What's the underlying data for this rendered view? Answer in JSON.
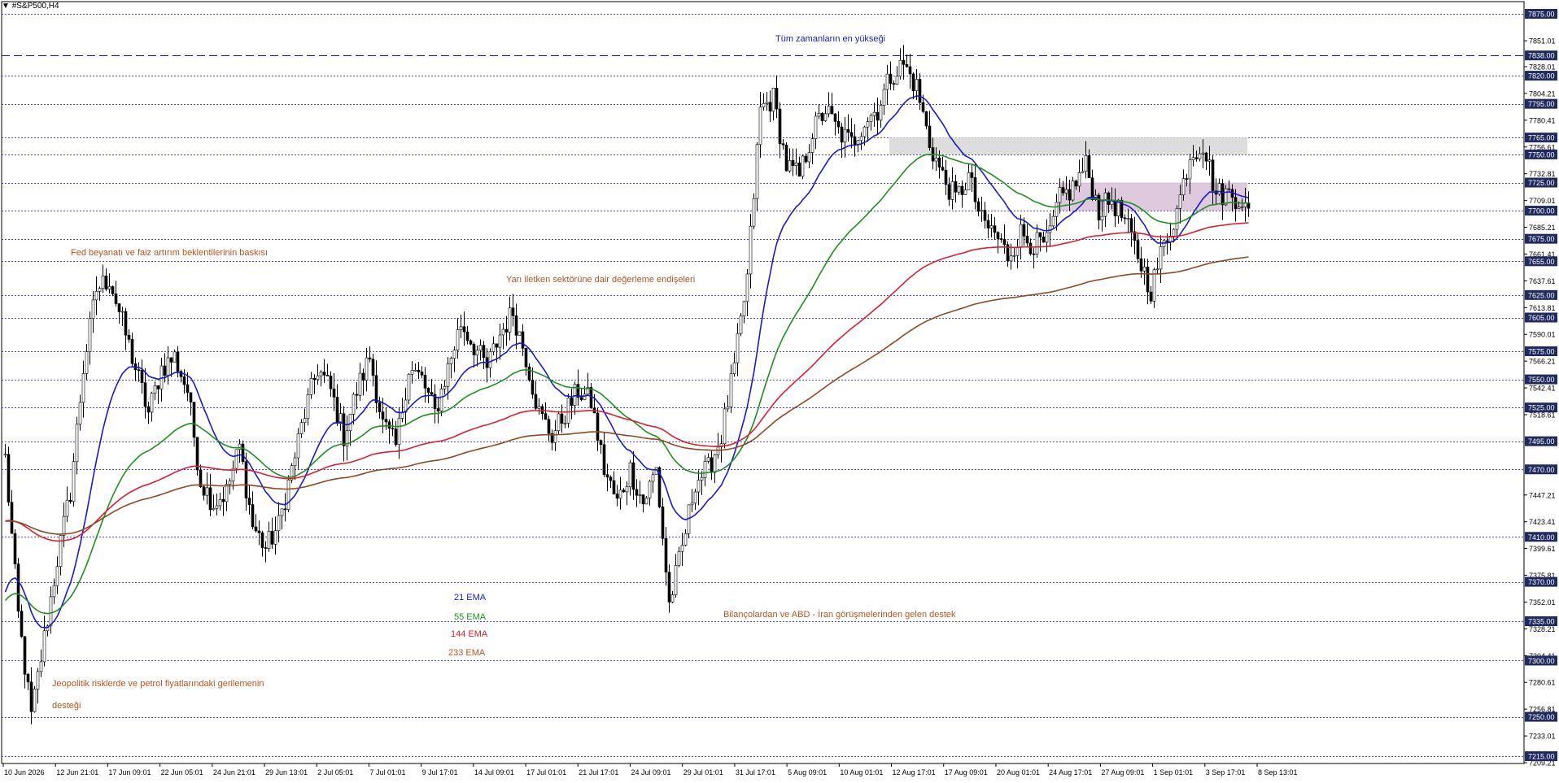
{
  "window": {
    "symbol_label": "#S&P500,H4"
  },
  "chart_data": {
    "type": "candlestick",
    "symbol": "#S&P500",
    "timeframe": "H4",
    "ylim": [
      7209.5,
      7875.0
    ],
    "price_ticks": [
      "7851.01",
      "7828.01",
      "7804.21",
      "7780.41",
      "7756.61",
      "7732.81",
      "7709.01",
      "7685.21",
      "7661.41",
      "7637.61",
      "7613.81",
      "7590.01",
      "7566.21",
      "7542.41",
      "7518.61",
      "7447.21",
      "7423.41",
      "7399.61",
      "7375.81",
      "7352.01",
      "7328.21",
      "7304.41",
      "7280.61",
      "7256.81",
      "7233.01",
      "7209.21"
    ],
    "levels": [
      {
        "value": 7875.0,
        "label": "7875.00",
        "style": "dotted"
      },
      {
        "value": 7838.0,
        "label": "7838.00",
        "style": "dashed"
      },
      {
        "value": 7820.0,
        "label": "7820.00",
        "style": "dotted"
      },
      {
        "value": 7795.0,
        "label": "7795.00",
        "style": "dotted"
      },
      {
        "value": 7765.0,
        "label": "7765.00",
        "style": "dotted"
      },
      {
        "value": 7750.0,
        "label": "7750.00",
        "style": "dotted"
      },
      {
        "value": 7725.0,
        "label": "7725.00",
        "style": "dotted"
      },
      {
        "value": 7700.0,
        "label": "7700.00",
        "style": "dotted"
      },
      {
        "value": 7675.0,
        "label": "7675.00",
        "style": "dotted"
      },
      {
        "value": 7655.0,
        "label": "7655.00",
        "style": "dotted"
      },
      {
        "value": 7625.0,
        "label": "7625.00",
        "style": "dotted"
      },
      {
        "value": 7605.0,
        "label": "7605.00",
        "style": "dotted"
      },
      {
        "value": 7575.0,
        "label": "7575.00",
        "style": "dotted"
      },
      {
        "value": 7550.0,
        "label": "7550.00",
        "style": "dotted"
      },
      {
        "value": 7525.0,
        "label": "7525.00",
        "style": "dotted"
      },
      {
        "value": 7495.0,
        "label": "7495.00",
        "style": "dotted"
      },
      {
        "value": 7470.0,
        "label": "7470.00",
        "style": "dotted"
      },
      {
        "value": 7410.0,
        "label": "7410.00",
        "style": "dotted"
      },
      {
        "value": 7370.0,
        "label": "7370.00",
        "style": "dotted"
      },
      {
        "value": 7335.0,
        "label": "7335.00",
        "style": "dotted"
      },
      {
        "value": 7300.0,
        "label": "7300.00",
        "style": "dotted"
      },
      {
        "value": 7250.0,
        "label": "7250.00",
        "style": "dotted"
      },
      {
        "value": 7215.0,
        "label": "7215.00",
        "style": "dotted"
      }
    ],
    "time_labels": [
      "10 Jun 2026",
      "12 Jun 21:01",
      "17 Jun 09:01",
      "22 Jun 05:01",
      "24 Jun 21:01",
      "29 Jun 13:01",
      "2 Jul 05:01",
      "7 Jul 01:01",
      "9 Jul 17:01",
      "14 Jul 09:01",
      "17 Jul 01:01",
      "21 Jul 17:01",
      "24 Jul 09:01",
      "29 Jul 01:01",
      "31 Jul 17:01",
      "5 Aug 09:01",
      "10 Aug 01:01",
      "12 Aug 17:01",
      "17 Aug 09:01",
      "20 Aug 01:01",
      "24 Aug 17:01",
      "27 Aug 09:01",
      "1 Sep 01:01",
      "3 Sep 17:01",
      "8 Sep 13:01"
    ],
    "price_anchors": [
      [
        0,
        7480
      ],
      [
        4,
        7340
      ],
      [
        8,
        7250
      ],
      [
        12,
        7320
      ],
      [
        16,
        7390
      ],
      [
        20,
        7450
      ],
      [
        24,
        7560
      ],
      [
        28,
        7630
      ],
      [
        32,
        7640
      ],
      [
        36,
        7600
      ],
      [
        40,
        7560
      ],
      [
        44,
        7520
      ],
      [
        48,
        7560
      ],
      [
        52,
        7570
      ],
      [
        56,
        7540
      ],
      [
        60,
        7460
      ],
      [
        64,
        7440
      ],
      [
        68,
        7450
      ],
      [
        72,
        7490
      ],
      [
        76,
        7420
      ],
      [
        80,
        7400
      ],
      [
        84,
        7420
      ],
      [
        88,
        7470
      ],
      [
        92,
        7520
      ],
      [
        96,
        7560
      ],
      [
        100,
        7540
      ],
      [
        104,
        7500
      ],
      [
        108,
        7540
      ],
      [
        112,
        7570
      ],
      [
        116,
        7510
      ],
      [
        120,
        7490
      ],
      [
        124,
        7560
      ],
      [
        128,
        7550
      ],
      [
        132,
        7520
      ],
      [
        136,
        7560
      ],
      [
        140,
        7600
      ],
      [
        144,
        7580
      ],
      [
        148,
        7560
      ],
      [
        152,
        7590
      ],
      [
        156,
        7610
      ],
      [
        160,
        7570
      ],
      [
        164,
        7520
      ],
      [
        168,
        7500
      ],
      [
        172,
        7520
      ],
      [
        176,
        7540
      ],
      [
        180,
        7530
      ],
      [
        184,
        7470
      ],
      [
        188,
        7440
      ],
      [
        192,
        7470
      ],
      [
        196,
        7440
      ],
      [
        200,
        7470
      ],
      [
        204,
        7350
      ],
      [
        208,
        7400
      ],
      [
        212,
        7460
      ],
      [
        216,
        7470
      ],
      [
        220,
        7500
      ],
      [
        224,
        7560
      ],
      [
        228,
        7640
      ],
      [
        232,
        7790
      ],
      [
        236,
        7800
      ],
      [
        240,
        7740
      ],
      [
        244,
        7730
      ],
      [
        248,
        7770
      ],
      [
        252,
        7790
      ],
      [
        256,
        7770
      ],
      [
        260,
        7760
      ],
      [
        264,
        7780
      ],
      [
        268,
        7790
      ],
      [
        272,
        7820
      ],
      [
        276,
        7830
      ],
      [
        280,
        7810
      ],
      [
        284,
        7760
      ],
      [
        288,
        7730
      ],
      [
        292,
        7710
      ],
      [
        296,
        7730
      ],
      [
        300,
        7690
      ],
      [
        304,
        7680
      ],
      [
        308,
        7660
      ],
      [
        312,
        7680
      ],
      [
        316,
        7670
      ],
      [
        320,
        7670
      ],
      [
        324,
        7710
      ],
      [
        328,
        7720
      ],
      [
        332,
        7740
      ],
      [
        336,
        7700
      ],
      [
        340,
        7710
      ],
      [
        344,
        7690
      ],
      [
        348,
        7660
      ],
      [
        352,
        7630
      ],
      [
        356,
        7670
      ],
      [
        360,
        7700
      ],
      [
        364,
        7750
      ],
      [
        368,
        7760
      ],
      [
        372,
        7715
      ],
      [
        376,
        7715
      ],
      [
        380,
        7710
      ],
      [
        382,
        7695
      ]
    ],
    "series": [
      {
        "name": "21 EMA",
        "color": "#1a1acc",
        "period": 21
      },
      {
        "name": "55 EMA",
        "color": "#1f8f1f",
        "period": 55
      },
      {
        "name": "144 EMA",
        "color": "#dc1e32",
        "period": 144
      },
      {
        "name": "233 EMA",
        "color": "#8b4a22",
        "period": 233
      }
    ],
    "zones": [
      {
        "from": 7765,
        "to": 7750,
        "x_start": 272,
        "x_end": 382,
        "color": "#d9d9d9"
      },
      {
        "from": 7725,
        "to": 7700,
        "x_start": 324,
        "x_end": 382,
        "color": "#dcc3dc"
      }
    ],
    "annotations": [
      {
        "id": "ath",
        "text": "Tüm zamanların en yükseği",
        "color": "#1a1acc"
      },
      {
        "id": "fed",
        "text": "Fed beyanatı ve faiz artırım beklentilerinin baskısı",
        "color": "#b8541e"
      },
      {
        "id": "semis",
        "text": "Yarı iletken sektörüne dair değerleme endişeleri",
        "color": "#b8541e"
      },
      {
        "id": "earnings",
        "text": "Bilançolardan ve ABD - İran görüşmelerinden gelen destek",
        "color": "#b8541e"
      },
      {
        "id": "geo1",
        "text": "Jeopolitik risklerde ve petrol fiyatlarındaki gerilemenin",
        "color": "#b8541e"
      },
      {
        "id": "geo2",
        "text": "desteği",
        "color": "#b8541e"
      }
    ],
    "legend": [
      {
        "text": "21 EMA",
        "color": "#1a1acc"
      },
      {
        "text": "55 EMA",
        "color": "#1f8f1f"
      },
      {
        "text": "144 EMA",
        "color": "#dc1e32"
      },
      {
        "text": "233 EMA",
        "color": "#b8541e"
      }
    ]
  }
}
